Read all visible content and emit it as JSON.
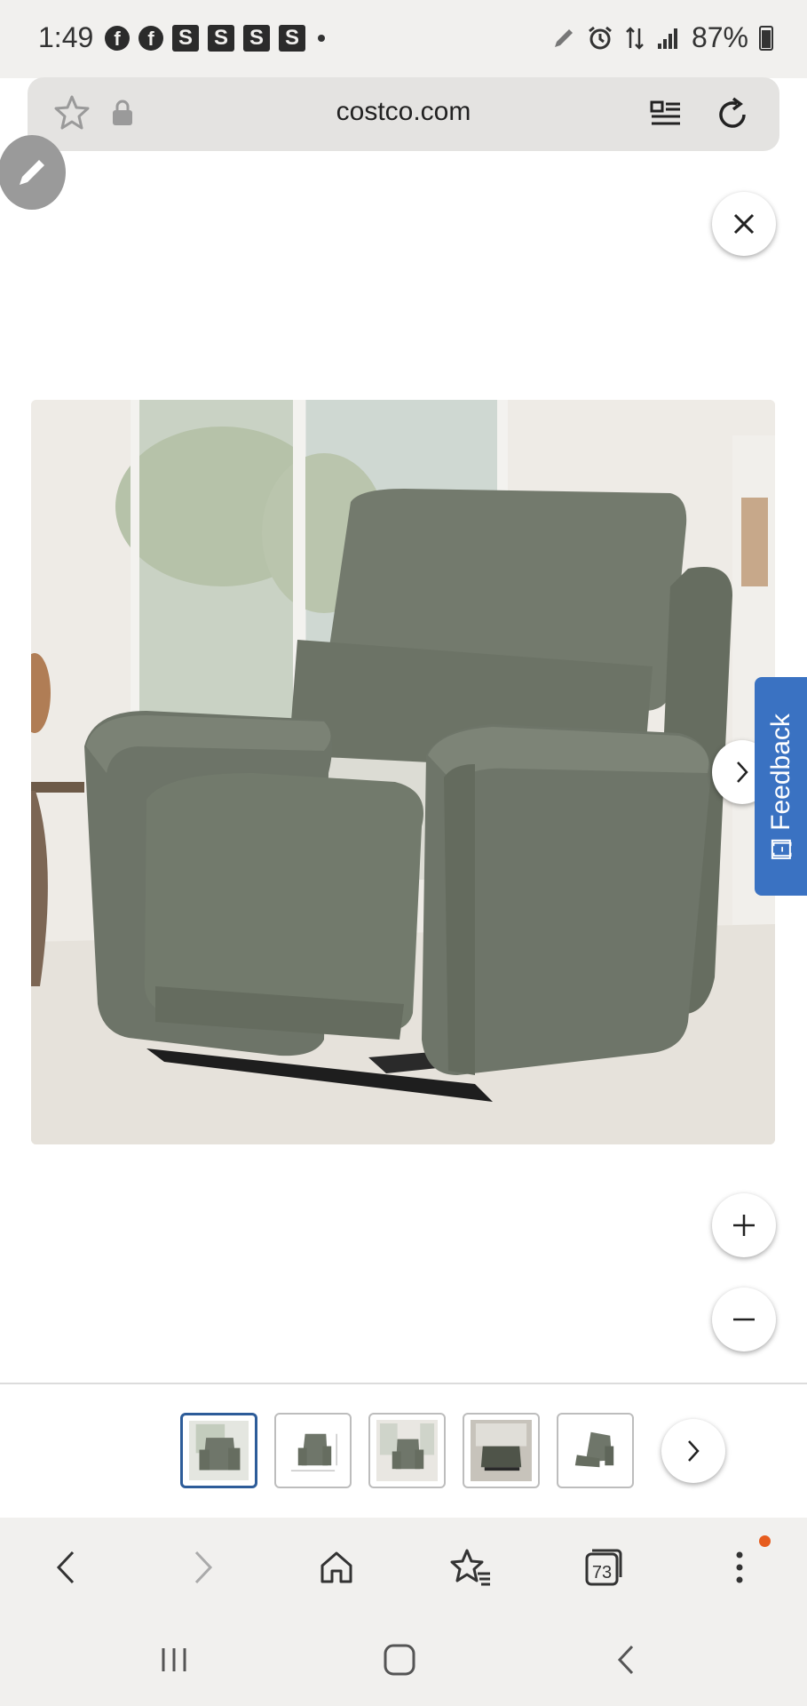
{
  "status_bar": {
    "time": "1:49",
    "notification_icons": [
      "facebook-icon",
      "facebook-icon",
      "S",
      "S",
      "S",
      "S"
    ],
    "battery": "87%"
  },
  "url_bar": {
    "url": "costco.com"
  },
  "product_viewer": {
    "image_alt": "Gray leather power lift recliner chair",
    "feedback_label": "Feedback",
    "feedback_mark": "[-]",
    "thumbnail_count": 5,
    "active_thumbnail": 0
  },
  "browser_bar": {
    "tab_count": "73"
  },
  "colors": {
    "accent": "#3a72c2",
    "active_thumb_border": "#2d5c99",
    "notification_dot": "#e65c1e",
    "chrome_bg": "#f1f0ee"
  }
}
